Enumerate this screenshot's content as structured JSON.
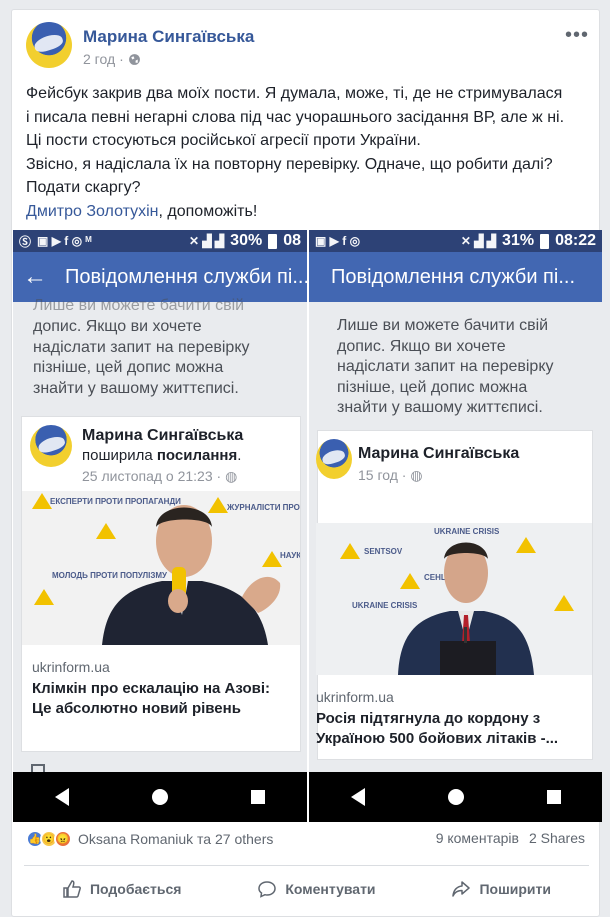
{
  "post": {
    "author": "Марина Сингаївська",
    "time": "2 год",
    "privacy_icon": "globe-icon",
    "more_icon": "•••",
    "text_lines": [
      "Фейсбук закрив два моїх пости. Я думала, може, ті, де не стримувалася",
      "і писала певні негарні слова під час учорашнього засідання ВР, але ж ні.",
      "Ці пости стосуються російської агресії проти України.",
      "Звісно, я надіслала їх на повторну перевірку. Одначе, що робити далі?",
      "Подати скаргу?"
    ],
    "mention": "Дмитро Золотухін",
    "mention_suffix": ", допоможіть!"
  },
  "screenshot1": {
    "status_battery": "30%",
    "status_time": "08",
    "appbar_title": "Повідомлення служби пі...",
    "note_top": "Лише ви можете бачити свій",
    "note": [
      "допис. Якщо ви хочете",
      "надіслати запит на перевірку",
      "пізніше, цей допис можна",
      "знайти у вашому життєписі."
    ],
    "card_author": "Марина Сингаївська",
    "card_action_prefix": "поширила ",
    "card_action_bold": "посилання",
    "card_action_suffix": ".",
    "card_time": "25 листопад о 21:23 · ",
    "photo_wall": [
      "ЕКСПЕРТИ ПРОТИ ПРОПАГАНДИ",
      "ЖУРНАЛІСТИ ПРОТИ",
      "МОЛОДЬ ПРОТИ ПОПУЛІЗМУ",
      "НАУК"
    ],
    "domain": "ukrinform.ua",
    "headline": [
      "Клімкін про ескалацію на Азові:",
      "Це абсолютно новий рівень"
    ]
  },
  "screenshot2": {
    "status_battery": "31%",
    "status_time": "08:22",
    "appbar_title": "Повідомлення служби пі...",
    "note": [
      "Лише ви можете бачити свій",
      "допис. Якщо ви хочете",
      "надіслати запит на перевірку",
      "пізніше, цей допис можна",
      "знайти у вашому життєписі."
    ],
    "card_author": "Марина Сингаївська",
    "card_time": "15 год · ",
    "photo_wall": [
      "UKRAINE CRISIS",
      "SENTSOV",
      "СЕНЦОВ",
      "UKRAINE CRISIS"
    ],
    "domain": "ukrinform.ua",
    "headline": [
      "Росія підтягнула до кордону з",
      "Україною 500 бойових літаків -..."
    ]
  },
  "reactions": {
    "names": "Oksana Romaniuk та 27 others",
    "comments": "9 коментарів",
    "shares": "2 Shares"
  },
  "actions": {
    "like": "Подобається",
    "comment": "Коментувати",
    "share": "Поширити"
  },
  "colors": {
    "fb_blue": "#4267b2",
    "link": "#365899",
    "status_bar": "#2d4276"
  }
}
